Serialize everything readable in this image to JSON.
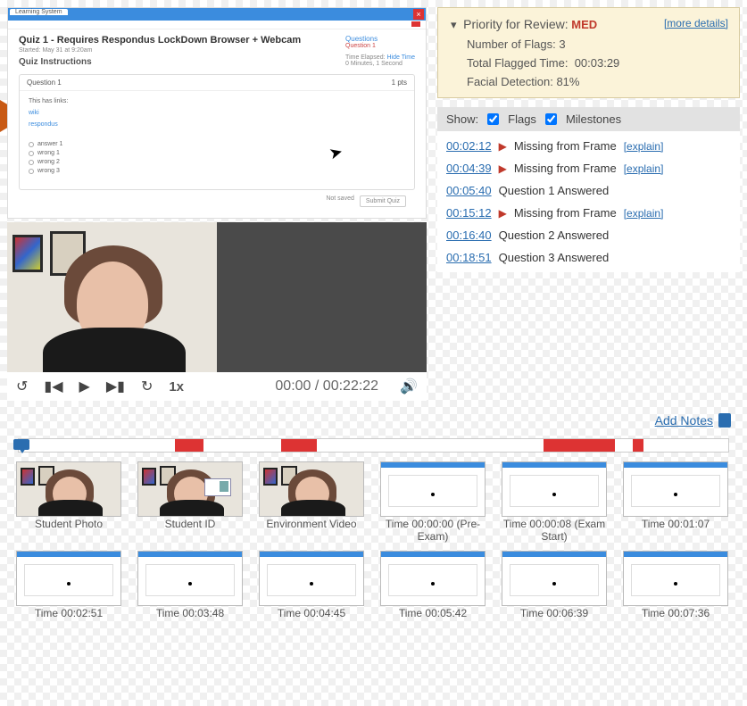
{
  "quiz": {
    "tab_label": "Learning System",
    "title": "Quiz 1 - Requires Respondus LockDown Browser + Webcam",
    "started": "Started: May 31 at 9:20am",
    "instructions_label": "Quiz Instructions",
    "sidebar": {
      "questions_label": "Questions",
      "question_link": "Question 1",
      "time_elapsed_label": "Time Elapsed:",
      "hide_time": "Hide Time",
      "elapsed_value": "0 Minutes, 1 Second"
    },
    "question": {
      "header": "Question 1",
      "points": "1 pts",
      "body_line": "This has links:",
      "wiki": "wiki",
      "respondus": "respondus",
      "opts": [
        "answer 1",
        "wrong 1",
        "wrong 2",
        "wrong 3"
      ]
    },
    "footer": {
      "not_saved": "Not saved",
      "submit": "Submit Quiz"
    }
  },
  "player": {
    "speed": "1x",
    "time_current": "00:00",
    "time_sep": " / ",
    "time_total": "00:22:22"
  },
  "priority": {
    "header_label": "Priority for Review:",
    "level": "MED",
    "more": "[more details]",
    "flags_label": "Number of Flags:",
    "flags_value": "3",
    "flagged_time_label": "Total Flagged Time:",
    "flagged_time_value": "00:03:29",
    "facial_label": "Facial Detection:",
    "facial_value": "81%"
  },
  "show": {
    "label": "Show:",
    "flags": "Flags",
    "milestones": "Milestones"
  },
  "events": [
    {
      "ts": "00:02:12",
      "flag": true,
      "text": "Missing from Frame",
      "explain": "[explain]"
    },
    {
      "ts": "00:04:39",
      "flag": true,
      "text": "Missing from Frame",
      "explain": "[explain]"
    },
    {
      "ts": "00:05:40",
      "flag": false,
      "text": "Question 1 Answered"
    },
    {
      "ts": "00:15:12",
      "flag": true,
      "text": "Missing from Frame",
      "explain": "[explain]"
    },
    {
      "ts": "00:16:40",
      "flag": false,
      "text": "Question 2 Answered"
    },
    {
      "ts": "00:18:51",
      "flag": false,
      "text": "Question 3 Answered"
    }
  ],
  "addnotes": "Add Notes",
  "timeline_segments": [
    {
      "left": 22.0,
      "width": 4.0
    },
    {
      "left": 37.0,
      "width": 5.0
    },
    {
      "left": 74.0,
      "width": 10.0
    },
    {
      "left": 86.5,
      "width": 1.5
    }
  ],
  "thumbs_row1": [
    {
      "type": "cam",
      "cap": "Student Photo"
    },
    {
      "type": "id",
      "cap": "Student ID"
    },
    {
      "type": "cam",
      "cap": "Environment Video"
    },
    {
      "type": "scr",
      "cap": "Time 00:00:00 (Pre-Exam)"
    },
    {
      "type": "scr",
      "cap": "Time 00:00:08 (Exam Start)"
    },
    {
      "type": "scr",
      "cap": "Time 00:01:07"
    }
  ],
  "thumbs_row2": [
    {
      "type": "scr",
      "cap": "Time 00:02:51"
    },
    {
      "type": "scr",
      "cap": "Time 00:03:48"
    },
    {
      "type": "scr",
      "cap": "Time 00:04:45"
    },
    {
      "type": "scr",
      "cap": "Time 00:05:42"
    },
    {
      "type": "scr",
      "cap": "Time 00:06:39"
    },
    {
      "type": "scr",
      "cap": "Time 00:07:36"
    }
  ]
}
